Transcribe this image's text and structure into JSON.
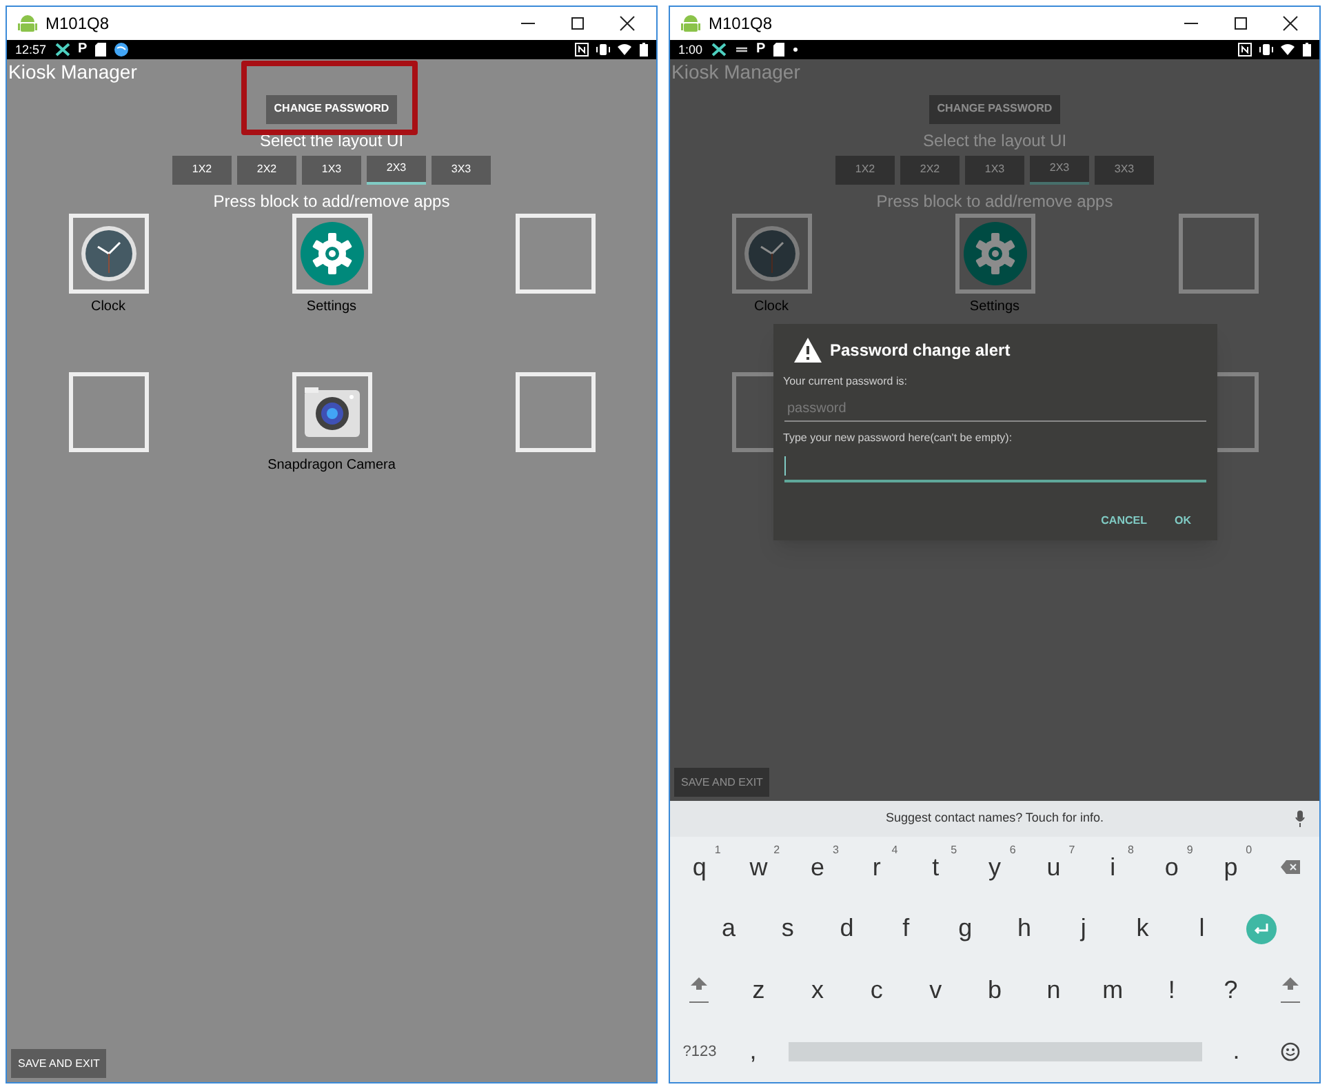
{
  "windows": [
    {
      "title": "M101Q8",
      "status_bar": {
        "time": "12:57",
        "left_icons": [
          {
            "kind": "tools"
          },
          {
            "kind": "char",
            "text": "P"
          },
          {
            "kind": "sdcard"
          },
          {
            "kind": "globe"
          }
        ],
        "right_icons": [
          {
            "kind": "nfc"
          },
          {
            "kind": "vibrate"
          },
          {
            "kind": "wifi"
          },
          {
            "kind": "battery"
          }
        ]
      },
      "app": {
        "title": "Kiosk Manager",
        "change_password": {
          "label": "CHANGE PASSWORD",
          "highlighted": true
        },
        "layout_prompt": "Select the layout UI",
        "layouts": [
          {
            "label": "1X2",
            "selected": false
          },
          {
            "label": "2X2",
            "selected": false
          },
          {
            "label": "1X3",
            "selected": false
          },
          {
            "label": "2X3",
            "selected": true
          },
          {
            "label": "3X3",
            "selected": false
          }
        ],
        "blocks_prompt": "Press block to add/remove apps",
        "blocks": [
          {
            "kind": "clock",
            "label": "Clock"
          },
          {
            "kind": "settings",
            "label": "Settings"
          },
          {
            "kind": "empty"
          },
          {
            "kind": "empty"
          },
          {
            "kind": "camera",
            "label": "Snapdragon Camera"
          },
          {
            "kind": "empty"
          }
        ],
        "save_button": "SAVE AND EXIT",
        "dimmed": false
      }
    },
    {
      "title": "M101Q8",
      "status_bar": {
        "time": "1:00",
        "left_icons": [
          {
            "kind": "tools"
          },
          {
            "kind": "dash"
          },
          {
            "kind": "char",
            "text": "P"
          },
          {
            "kind": "sdcard"
          },
          {
            "kind": "dot"
          }
        ],
        "right_icons": [
          {
            "kind": "nfc"
          },
          {
            "kind": "vibrate"
          },
          {
            "kind": "wifi"
          },
          {
            "kind": "battery"
          }
        ]
      },
      "app": {
        "title": "Kiosk Manager",
        "change_password": {
          "label": "CHANGE PASSWORD",
          "highlighted": false
        },
        "layout_prompt": "Select the layout UI",
        "layouts": [
          {
            "label": "1X2",
            "selected": false
          },
          {
            "label": "2X2",
            "selected": false
          },
          {
            "label": "1X3",
            "selected": false
          },
          {
            "label": "2X3",
            "selected": true
          },
          {
            "label": "3X3",
            "selected": false
          }
        ],
        "blocks_prompt": "Press block to add/remove apps",
        "blocks": [
          {
            "kind": "clock",
            "label": "Clock"
          },
          {
            "kind": "settings",
            "label": "Settings"
          },
          {
            "kind": "empty"
          },
          {
            "kind": "empty"
          },
          {
            "kind": "covered"
          },
          {
            "kind": "empty"
          }
        ],
        "save_button": "SAVE AND EXIT",
        "dimmed": true
      },
      "dialog": {
        "title": "Password change alert",
        "current_label": "Your current password is:",
        "current_placeholder": "password",
        "new_label": "Type your new password here(can't be empty):",
        "buttons": [
          "CANCEL",
          "OK"
        ]
      },
      "keyboard": {
        "suggestion": "Suggest contact names? Touch for info.",
        "rows": [
          [
            {
              "kind": "letter",
              "label": "q",
              "hint": "1"
            },
            {
              "kind": "letter",
              "label": "w",
              "hint": "2"
            },
            {
              "kind": "letter",
              "label": "e",
              "hint": "3"
            },
            {
              "kind": "letter",
              "label": "r",
              "hint": "4"
            },
            {
              "kind": "letter",
              "label": "t",
              "hint": "5"
            },
            {
              "kind": "letter",
              "label": "y",
              "hint": "6"
            },
            {
              "kind": "letter",
              "label": "u",
              "hint": "7"
            },
            {
              "kind": "letter",
              "label": "i",
              "hint": "8"
            },
            {
              "kind": "letter",
              "label": "o",
              "hint": "9"
            },
            {
              "kind": "letter",
              "label": "p",
              "hint": "0"
            },
            {
              "kind": "backspace"
            }
          ],
          [
            {
              "kind": "letter",
              "label": "a"
            },
            {
              "kind": "letter",
              "label": "s"
            },
            {
              "kind": "letter",
              "label": "d"
            },
            {
              "kind": "letter",
              "label": "f"
            },
            {
              "kind": "letter",
              "label": "g"
            },
            {
              "kind": "letter",
              "label": "h"
            },
            {
              "kind": "letter",
              "label": "j"
            },
            {
              "kind": "letter",
              "label": "k"
            },
            {
              "kind": "letter",
              "label": "l"
            },
            {
              "kind": "enter"
            }
          ],
          [
            {
              "kind": "shift"
            },
            {
              "kind": "letter",
              "label": "z"
            },
            {
              "kind": "letter",
              "label": "x"
            },
            {
              "kind": "letter",
              "label": "c"
            },
            {
              "kind": "letter",
              "label": "v"
            },
            {
              "kind": "letter",
              "label": "b"
            },
            {
              "kind": "letter",
              "label": "n"
            },
            {
              "kind": "letter",
              "label": "m"
            },
            {
              "kind": "letter",
              "label": "!"
            },
            {
              "kind": "letter",
              "label": "?"
            },
            {
              "kind": "shift"
            }
          ],
          [
            {
              "kind": "symbols",
              "label": "?123"
            },
            {
              "kind": "letter",
              "label": ","
            },
            {
              "kind": "space"
            },
            {
              "kind": "letter",
              "label": "."
            },
            {
              "kind": "emoji"
            }
          ]
        ]
      }
    }
  ]
}
